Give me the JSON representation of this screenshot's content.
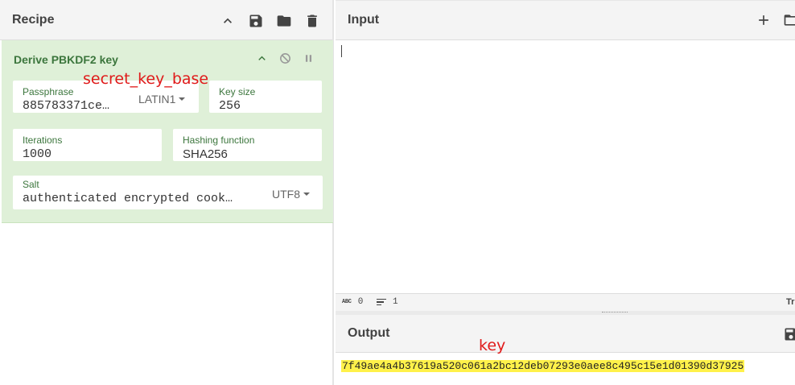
{
  "recipe": {
    "title": "Recipe",
    "header_icons": [
      "chevron-up-icon",
      "save-icon",
      "folder-icon",
      "trash-icon"
    ],
    "operation": {
      "title": "Derive PBKDF2 key",
      "passphrase": {
        "label": "Passphrase",
        "value": "885783371ce…",
        "encoding": "LATIN1"
      },
      "key_size": {
        "label": "Key size",
        "value": "256"
      },
      "iterations": {
        "label": "Iterations",
        "value": "1000"
      },
      "hashing": {
        "label": "Hashing function",
        "value": "SHA256"
      },
      "salt": {
        "label": "Salt",
        "value": "authenticated encrypted cook…",
        "encoding": "UTF8"
      }
    }
  },
  "input": {
    "title": "Input",
    "status": {
      "chars": "0",
      "lines": "1",
      "right_glyph": "Tr"
    }
  },
  "output": {
    "title": "Output",
    "value": "7f49ae4a4b37619a520c061a2bc12deb07293e0aee8c495c15e1d01390d37925"
  },
  "annotations": {
    "secret": "secret_key_base",
    "key": "key"
  },
  "colors": {
    "op_bg": "#dff0d8",
    "op_text": "#3c763d",
    "highlight": "#fff14a",
    "annotation": "#e01a1a"
  }
}
